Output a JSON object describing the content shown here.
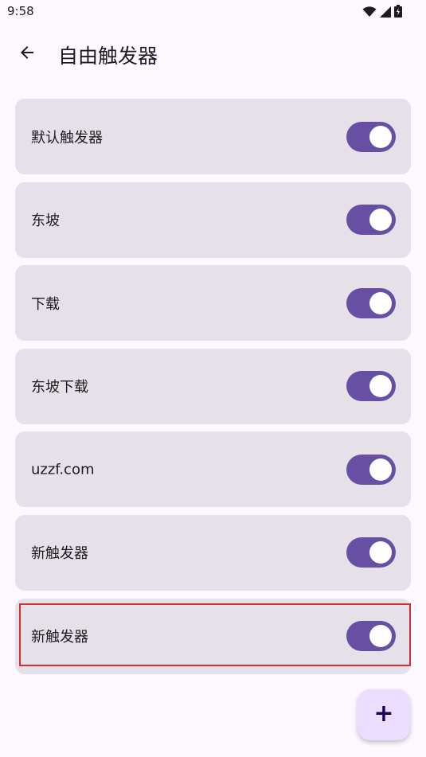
{
  "status_bar": {
    "time": "9:58",
    "icons": [
      "wifi-icon",
      "signal-icon",
      "battery-icon"
    ]
  },
  "app_bar": {
    "back_icon": "arrow-back-icon",
    "title": "自由触发器"
  },
  "triggers": [
    {
      "label": "默认触发器",
      "enabled": true
    },
    {
      "label": "东坡",
      "enabled": true
    },
    {
      "label": "下载",
      "enabled": true
    },
    {
      "label": "东坡下载",
      "enabled": true
    },
    {
      "label": "uzzf.com",
      "enabled": true
    },
    {
      "label": "新触发器",
      "enabled": true
    },
    {
      "label": "新触发器",
      "enabled": true
    }
  ],
  "fab": {
    "label": "+",
    "icon": "add-icon"
  },
  "colors": {
    "background": "#fdf7ff",
    "card": "#e6e0e9",
    "switch_on": "#6750a4",
    "fab": "#eaddff",
    "highlight": "#d32f2f"
  }
}
